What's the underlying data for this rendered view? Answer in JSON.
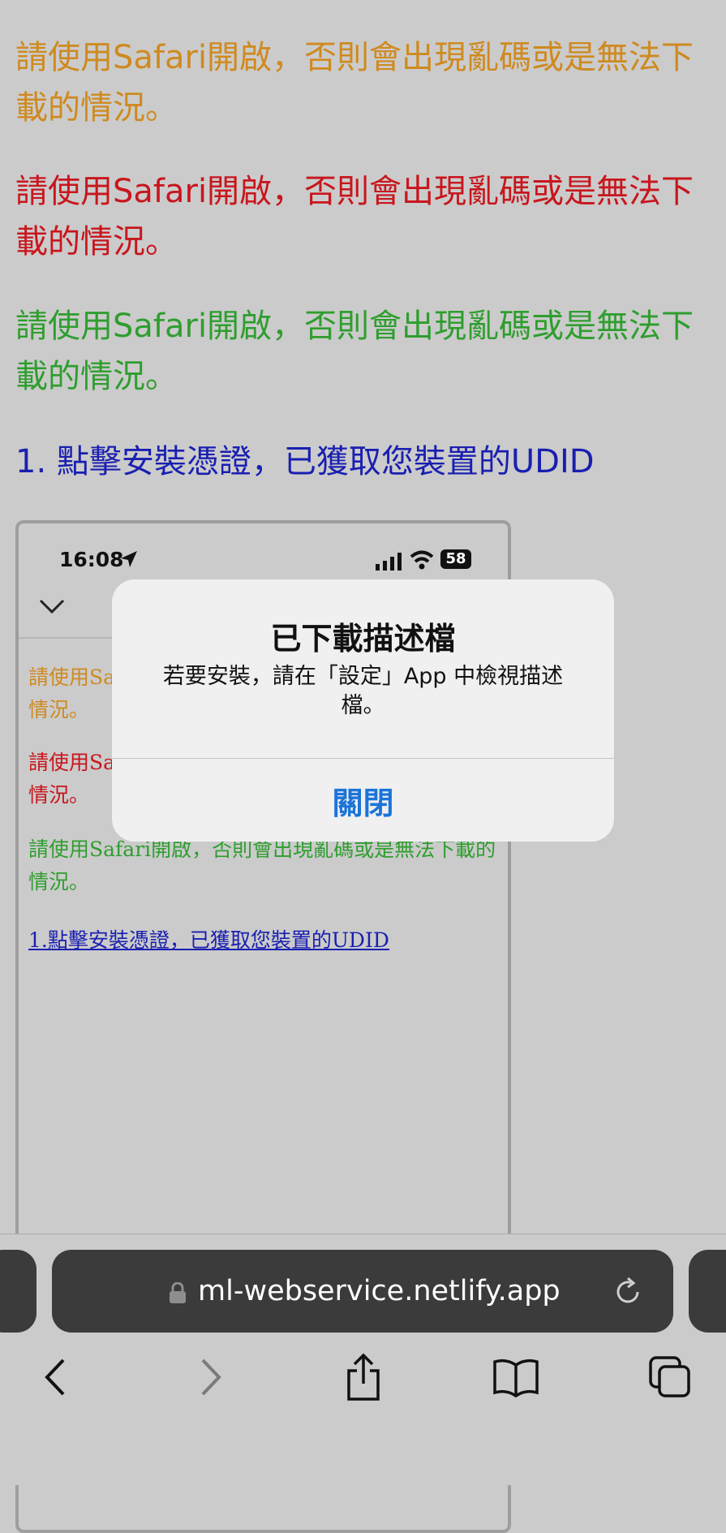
{
  "page": {
    "notice_lines": [
      "請使用Safari開啟，否則會出現亂碼或是無法下載的情況。",
      "請使用Safari開啟，否則會出現亂碼或是無法下載的情況。",
      "請使用Safari開啟，否則會出現亂碼或是無法下載的情況。"
    ],
    "notice_colors": [
      "#cf8a1f",
      "#c8161d",
      "#2e9e2e"
    ],
    "step1_link": "1. 點擊安裝憑證，已獲取您裝置的UDID"
  },
  "screenshot": {
    "time": "16:08",
    "battery": "58",
    "lines": [
      "請使用Safari開啟，否則會出現亂碼或是無法下載的情況。",
      "請使用Safari開啟，否則會出現亂碼或是無法下載的情況。",
      "請使用Safari開啟，否則會出現亂碼或是無法下載的情況。"
    ],
    "link": "1.點擊安裝憑證，已獲取您裝置的UDID"
  },
  "alert": {
    "title": "已下載描述檔",
    "message": "若要安裝，請在「設定」App 中檢視描述檔。",
    "close_button": "關閉"
  },
  "browser": {
    "url": "ml-webservice.netlify.app",
    "icons": {
      "lock": "lock-icon",
      "reload": "reload-icon",
      "back": "back-chevron-icon",
      "forward": "forward-chevron-icon",
      "share": "share-icon",
      "bookmarks": "book-icon",
      "tabs": "tabs-icon"
    }
  }
}
